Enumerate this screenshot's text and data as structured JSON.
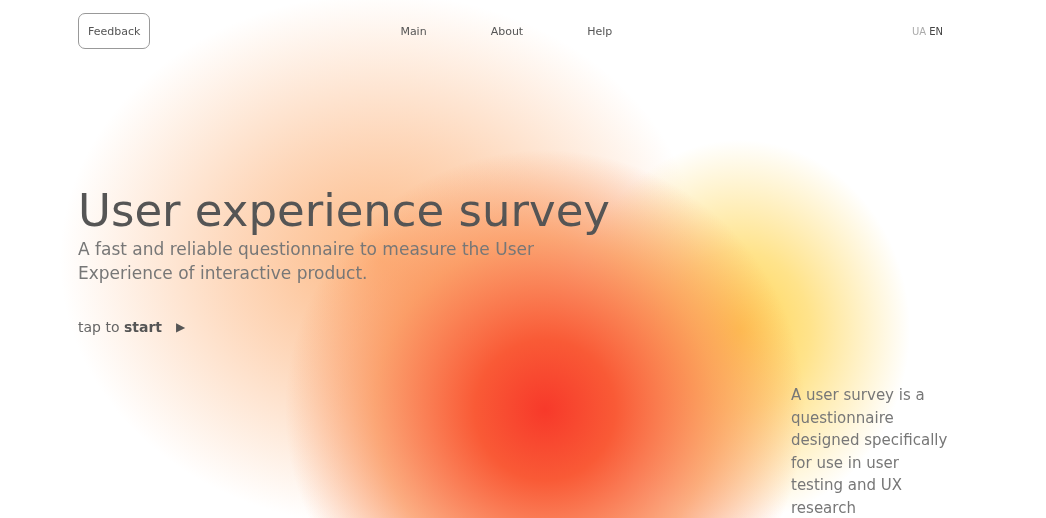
{
  "header": {
    "feedback_button": "Feedback",
    "nav": [
      {
        "label": "Main"
      },
      {
        "label": "About"
      },
      {
        "label": "Help"
      }
    ],
    "languages": [
      {
        "label": "UA",
        "selected": false
      },
      {
        "label": "EN",
        "selected": true
      }
    ]
  },
  "hero": {
    "title": "User experience survey",
    "subtitle": "A fast and reliable questionnaire to measure the User Experience of interactive product.",
    "cta": "tap to **start**",
    "cta_icon": "▶"
  },
  "aside": {
    "text": "A user survey is a questionnaire designed specifically for use in user testing and UX research"
  }
}
